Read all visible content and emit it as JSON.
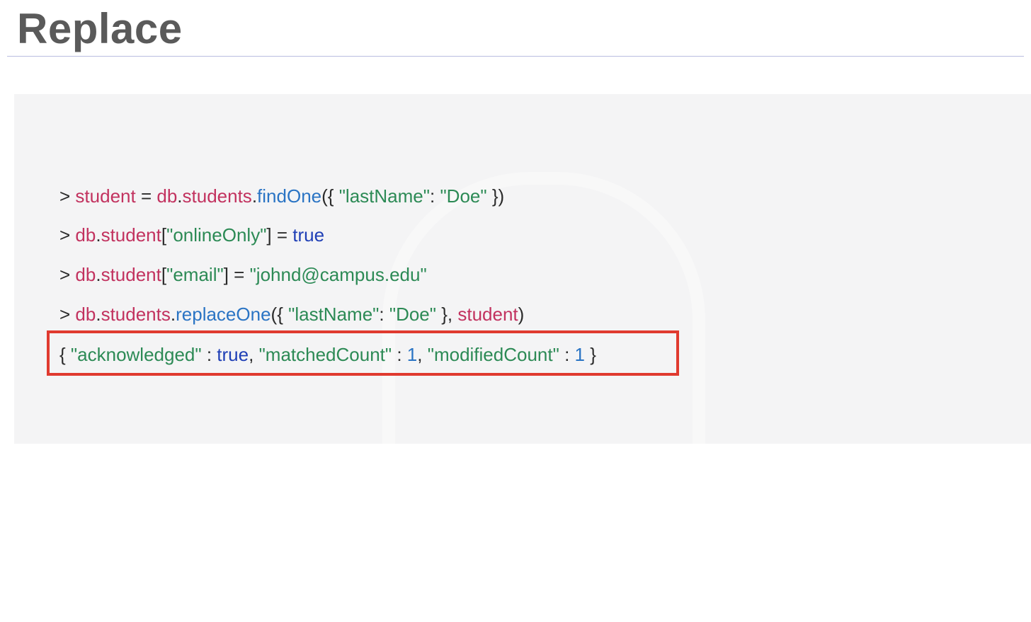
{
  "slide": {
    "title": "Replace"
  },
  "code": {
    "lines": [
      {
        "tokens": [
          {
            "text": "> ",
            "type": "punc"
          },
          {
            "text": "student",
            "type": "var"
          },
          {
            "text": " = ",
            "type": "punc"
          },
          {
            "text": "db",
            "type": "var"
          },
          {
            "text": ".",
            "type": "punc"
          },
          {
            "text": "students",
            "type": "var"
          },
          {
            "text": ".",
            "type": "punc"
          },
          {
            "text": "findOne",
            "type": "fn"
          },
          {
            "text": "({ ",
            "type": "punc"
          },
          {
            "text": "\"lastName\"",
            "type": "str"
          },
          {
            "text": ": ",
            "type": "punc"
          },
          {
            "text": "\"Doe\"",
            "type": "str"
          },
          {
            "text": " })",
            "type": "punc"
          }
        ]
      },
      {
        "tokens": [
          {
            "text": "> ",
            "type": "punc"
          },
          {
            "text": "db",
            "type": "var"
          },
          {
            "text": ".",
            "type": "punc"
          },
          {
            "text": "student",
            "type": "var"
          },
          {
            "text": "[",
            "type": "punc"
          },
          {
            "text": "\"onlineOnly\"",
            "type": "str"
          },
          {
            "text": "] = ",
            "type": "punc"
          },
          {
            "text": "true",
            "type": "kw"
          }
        ]
      },
      {
        "tokens": [
          {
            "text": "> ",
            "type": "punc"
          },
          {
            "text": "db",
            "type": "var"
          },
          {
            "text": ".",
            "type": "punc"
          },
          {
            "text": "student",
            "type": "var"
          },
          {
            "text": "[",
            "type": "punc"
          },
          {
            "text": "\"email\"",
            "type": "str"
          },
          {
            "text": "] = ",
            "type": "punc"
          },
          {
            "text": "\"johnd@campus.edu\"",
            "type": "str"
          }
        ]
      },
      {
        "tokens": [
          {
            "text": "> ",
            "type": "punc"
          },
          {
            "text": "db",
            "type": "var"
          },
          {
            "text": ".",
            "type": "punc"
          },
          {
            "text": "students",
            "type": "var"
          },
          {
            "text": ".",
            "type": "punc"
          },
          {
            "text": "replaceOne",
            "type": "fn"
          },
          {
            "text": "({ ",
            "type": "punc"
          },
          {
            "text": "\"lastName\"",
            "type": "str"
          },
          {
            "text": ": ",
            "type": "punc"
          },
          {
            "text": "\"Doe\"",
            "type": "str"
          },
          {
            "text": " }, ",
            "type": "punc"
          },
          {
            "text": "student",
            "type": "var"
          },
          {
            "text": ")",
            "type": "punc"
          }
        ]
      },
      {
        "highlighted": true,
        "tokens": [
          {
            "text": "{ ",
            "type": "punc"
          },
          {
            "text": "\"acknowledged\"",
            "type": "str"
          },
          {
            "text": " : ",
            "type": "punc"
          },
          {
            "text": "true",
            "type": "kw"
          },
          {
            "text": ", ",
            "type": "punc"
          },
          {
            "text": "\"matchedCount\"",
            "type": "str"
          },
          {
            "text": " : ",
            "type": "punc"
          },
          {
            "text": "1",
            "type": "num"
          },
          {
            "text": ", ",
            "type": "punc"
          },
          {
            "text": "\"modifiedCount\"",
            "type": "str"
          },
          {
            "text": " : ",
            "type": "punc"
          },
          {
            "text": "1",
            "type": "num"
          },
          {
            "text": " }",
            "type": "punc"
          }
        ]
      }
    ]
  },
  "colors": {
    "title": "#5a5a5a",
    "rule": "#b9bde0",
    "panel_bg": "#f4f4f5",
    "highlight_border": "#e03a2f",
    "var": "#c2325f",
    "fn": "#2a74c4",
    "str": "#2c8a55",
    "kw": "#1f3fb6",
    "num": "#2a74c4"
  }
}
